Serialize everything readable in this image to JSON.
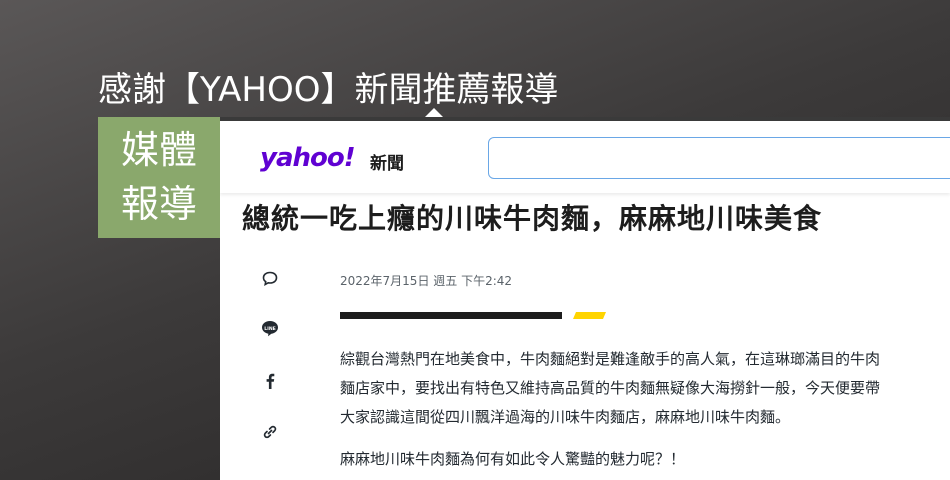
{
  "slide": {
    "title": "感謝【YAHOO】新聞推薦報導",
    "badge_line1": "媒體",
    "badge_line2": "報導"
  },
  "yahoo": {
    "logo": "yahoo!",
    "section": "新聞",
    "brand_color": "#6001d2"
  },
  "article": {
    "headline": "總統一吃上癮的川味牛肉麵，麻麻地川味美食",
    "date": "2022年7月15日 週五 下午2:42",
    "paragraph1_lines": [
      "綜觀台灣熱門在地美食中，牛肉麵絕對是難逢敵手的高人氣，在這琳瑯滿目的牛肉",
      "麵店家中，要找出有特色又維持高品質的牛肉麵無疑像大海撈針一般，今天便要帶",
      "大家認識這間從四川飄洋過海的川味牛肉麵店，麻麻地川味牛肉麵。"
    ],
    "paragraph2": "麻麻地川味牛肉麵為何有如此令人驚豔的魅力呢？！"
  },
  "share_icons": [
    "comment-icon",
    "line-icon",
    "facebook-icon",
    "link-icon"
  ],
  "colors": {
    "badge": "#8aa86c",
    "divider_black": "#1d1d1d",
    "divider_yellow": "#ffd400"
  }
}
